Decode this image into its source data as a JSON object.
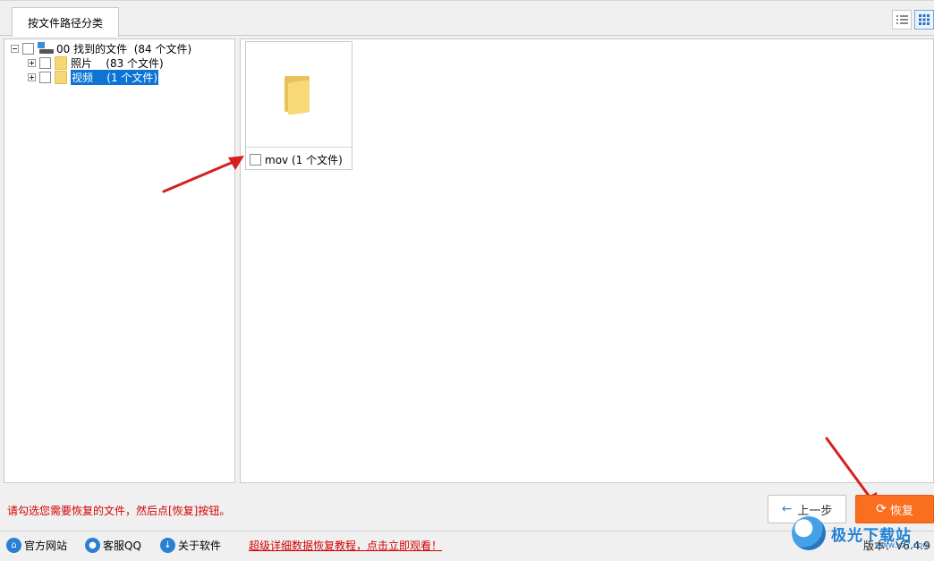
{
  "tabs": [
    {
      "label": "按文件路径分类",
      "active": true
    }
  ],
  "view_toggle": {
    "list_icon": "list-view-icon",
    "grid_icon": "grid-view-icon",
    "active": "grid"
  },
  "tree": {
    "root": {
      "label": "00 找到的文件  (84 个文件)",
      "expanded": true,
      "checked": false
    },
    "children": [
      {
        "label": "照片    (83 个文件)",
        "expanded": false,
        "checked": false,
        "selected": false
      },
      {
        "label": "视频    (1 个文件)",
        "expanded": false,
        "checked": false,
        "selected": true
      }
    ]
  },
  "content": {
    "items": [
      {
        "label": "mov  (1 个文件)",
        "checked": false,
        "icon": "folder-icon"
      }
    ]
  },
  "status": {
    "hint": "请勾选您需要恢复的文件，然后点[恢复]按钮。",
    "prev_label": "上一步",
    "recover_label": "恢复"
  },
  "footer": {
    "official_site": "官方网站",
    "support_qq": "客服QQ",
    "about": "关于软件",
    "tutorial_link": "超级详细数据恢复教程，点击立即观看！",
    "version": "版本：V6.4.9"
  },
  "watermark": {
    "text": "极光下载站",
    "url": "www.xz7.com"
  },
  "colors": {
    "accent": "#0b74d4",
    "recover": "#f96e1f",
    "hint": "#d40000",
    "arrow": "#d42020"
  }
}
